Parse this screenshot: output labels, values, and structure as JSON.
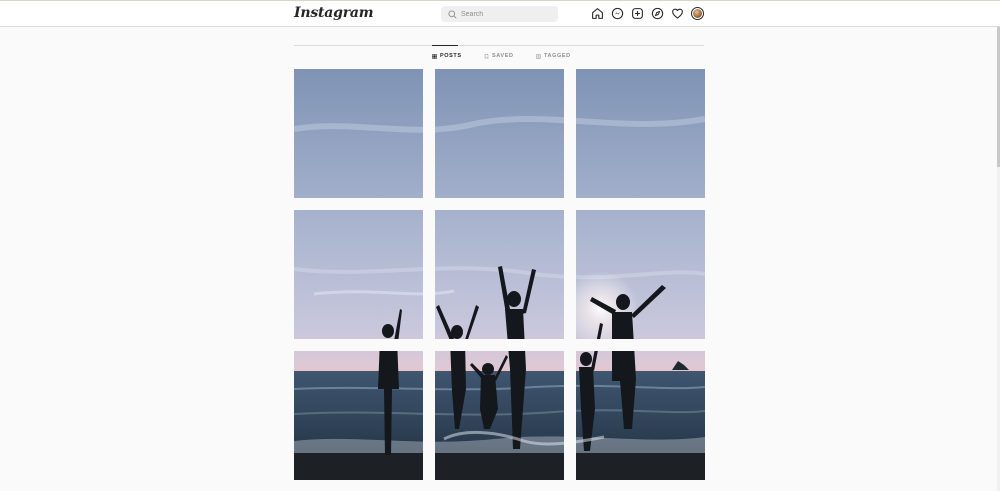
{
  "header": {
    "logo": "Instagram",
    "search": {
      "placeholder": "Search",
      "value": ""
    },
    "nav_icons": [
      "home-icon",
      "messenger-icon",
      "new-post-icon",
      "explore-icon",
      "activity-heart-icon",
      "profile-avatar"
    ]
  },
  "tabs": [
    {
      "label": "POSTS",
      "icon": "grid-icon",
      "active": true
    },
    {
      "label": "SAVED",
      "icon": "bookmark-icon",
      "active": false
    },
    {
      "label": "TAGGED",
      "icon": "tag-icon",
      "active": false
    }
  ],
  "colors": {
    "text": "#262626",
    "muted": "#8e8e8e",
    "background": "#fafafa",
    "border": "#dbdbdb",
    "search_bg": "#efefef"
  },
  "posts": {
    "count_visible": 9,
    "description": "beach sunset silhouettes"
  }
}
